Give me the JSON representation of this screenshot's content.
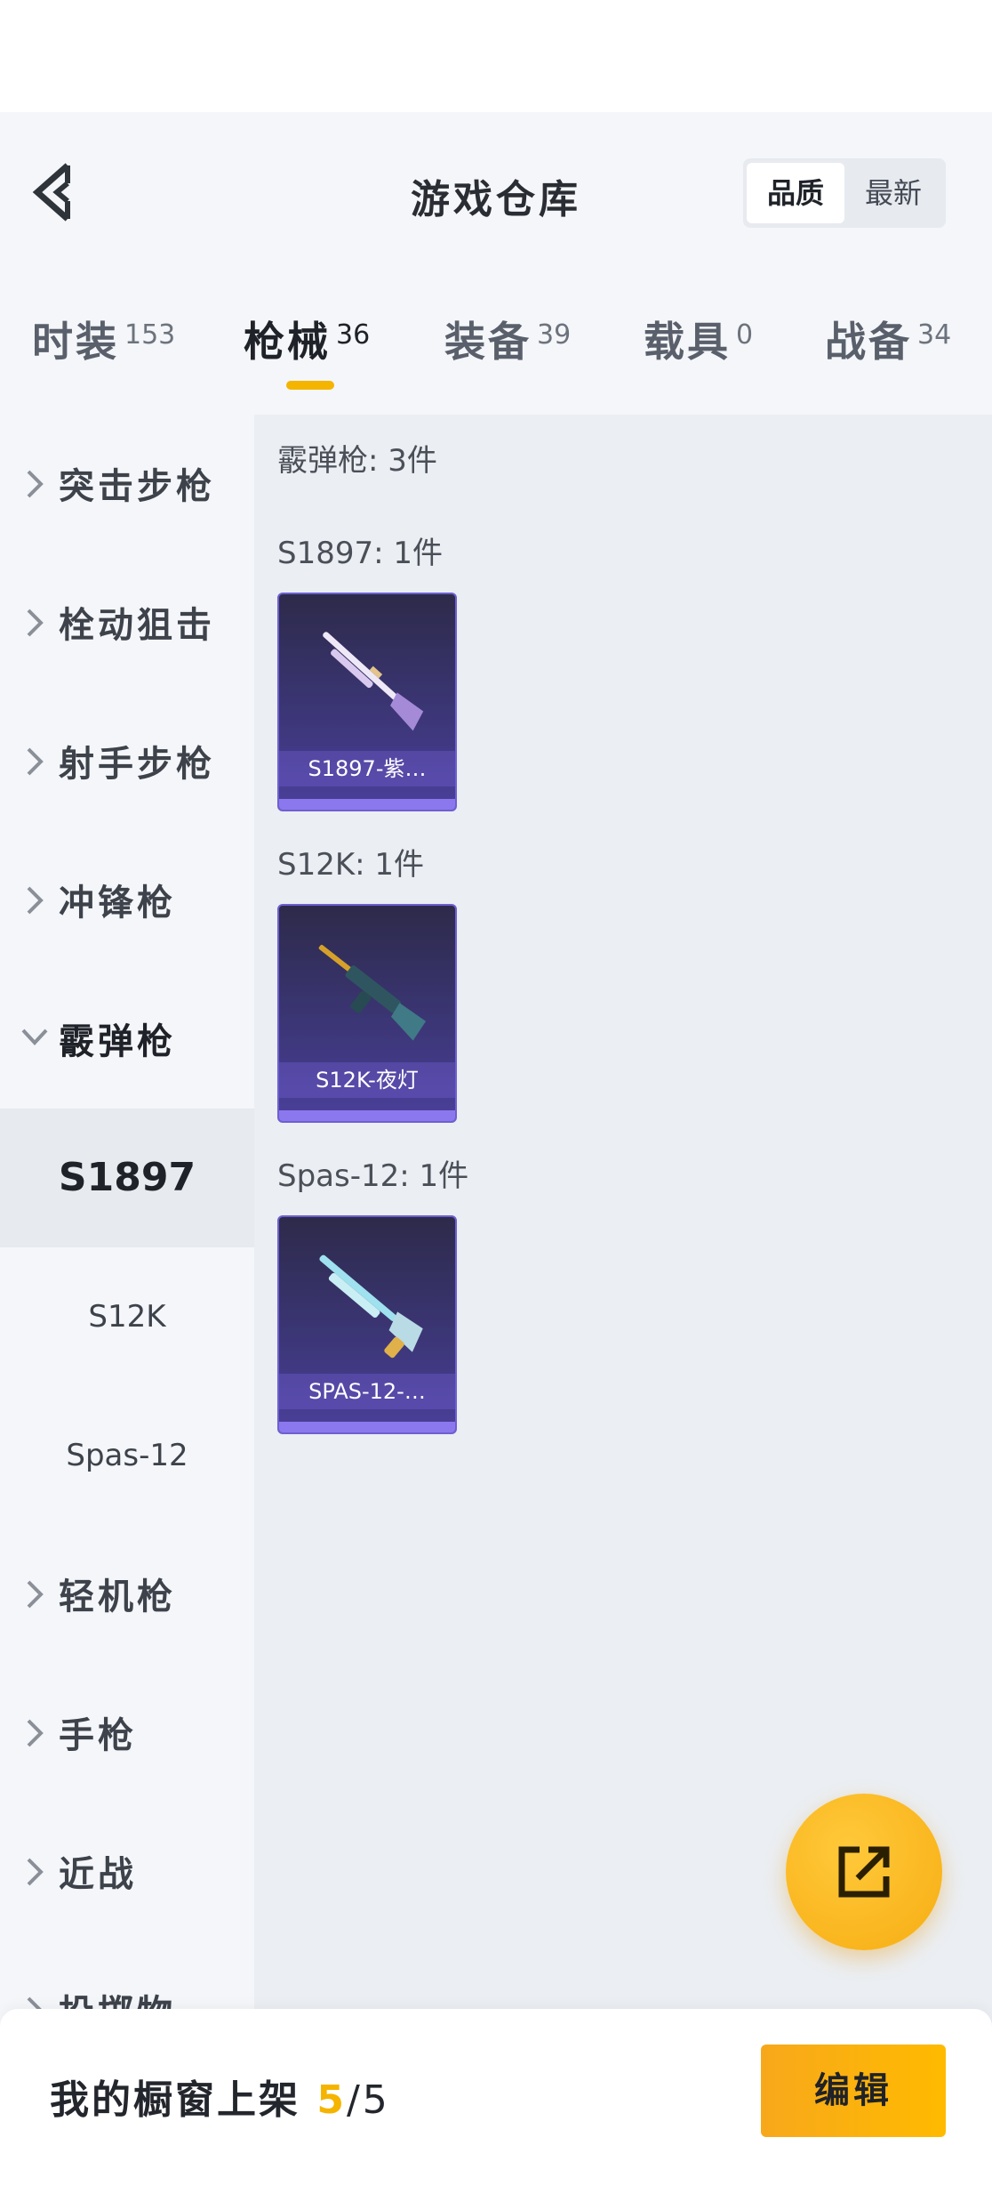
{
  "header": {
    "title": "游戏仓库",
    "sort_options": [
      {
        "label": "品质",
        "active": true
      },
      {
        "label": "最新",
        "active": false
      }
    ]
  },
  "tabs": [
    {
      "label": "时装",
      "count": "153",
      "active": false
    },
    {
      "label": "枪械",
      "count": "36",
      "active": true
    },
    {
      "label": "装备",
      "count": "39",
      "active": false
    },
    {
      "label": "载具",
      "count": "0",
      "active": false
    },
    {
      "label": "战备",
      "count": "34",
      "active": false
    }
  ],
  "sidebar": {
    "categories": [
      {
        "label": "突击步枪"
      },
      {
        "label": "栓动狙击"
      },
      {
        "label": "射手步枪"
      },
      {
        "label": "冲锋枪"
      },
      {
        "label": "霰弹枪",
        "expanded": true,
        "subitems": [
          {
            "label": "S1897",
            "active": true
          },
          {
            "label": "S12K"
          },
          {
            "label": "Spas-12"
          }
        ]
      },
      {
        "label": "轻机枪"
      },
      {
        "label": "手枪"
      },
      {
        "label": "近战"
      },
      {
        "label": "投掷物"
      }
    ]
  },
  "content": {
    "group_title": "霰弹枪: 3件",
    "sections": [
      {
        "heading": "S1897: 1件",
        "items": [
          {
            "name": "S1897-紫…",
            "icon": "shotgun-pump-lilac-icon"
          }
        ]
      },
      {
        "heading": "S12K: 1件",
        "items": [
          {
            "name": "S12K-夜灯",
            "icon": "shotgun-s12k-night-icon"
          }
        ]
      },
      {
        "heading": "Spas-12: 1件",
        "items": [
          {
            "name": "SPAS-12-…",
            "icon": "shotgun-spas-aqua-icon"
          }
        ]
      }
    ]
  },
  "fab": {
    "icon": "share-external-icon"
  },
  "bottom": {
    "showcase_label": "我的橱窗上架 ",
    "showcase_current": "5",
    "showcase_total": "/5",
    "edit_label": "编辑"
  },
  "colors": {
    "accent": "#f5b400",
    "card_purple": "#4a3f9a",
    "panel_bg": "#ebeef2"
  }
}
